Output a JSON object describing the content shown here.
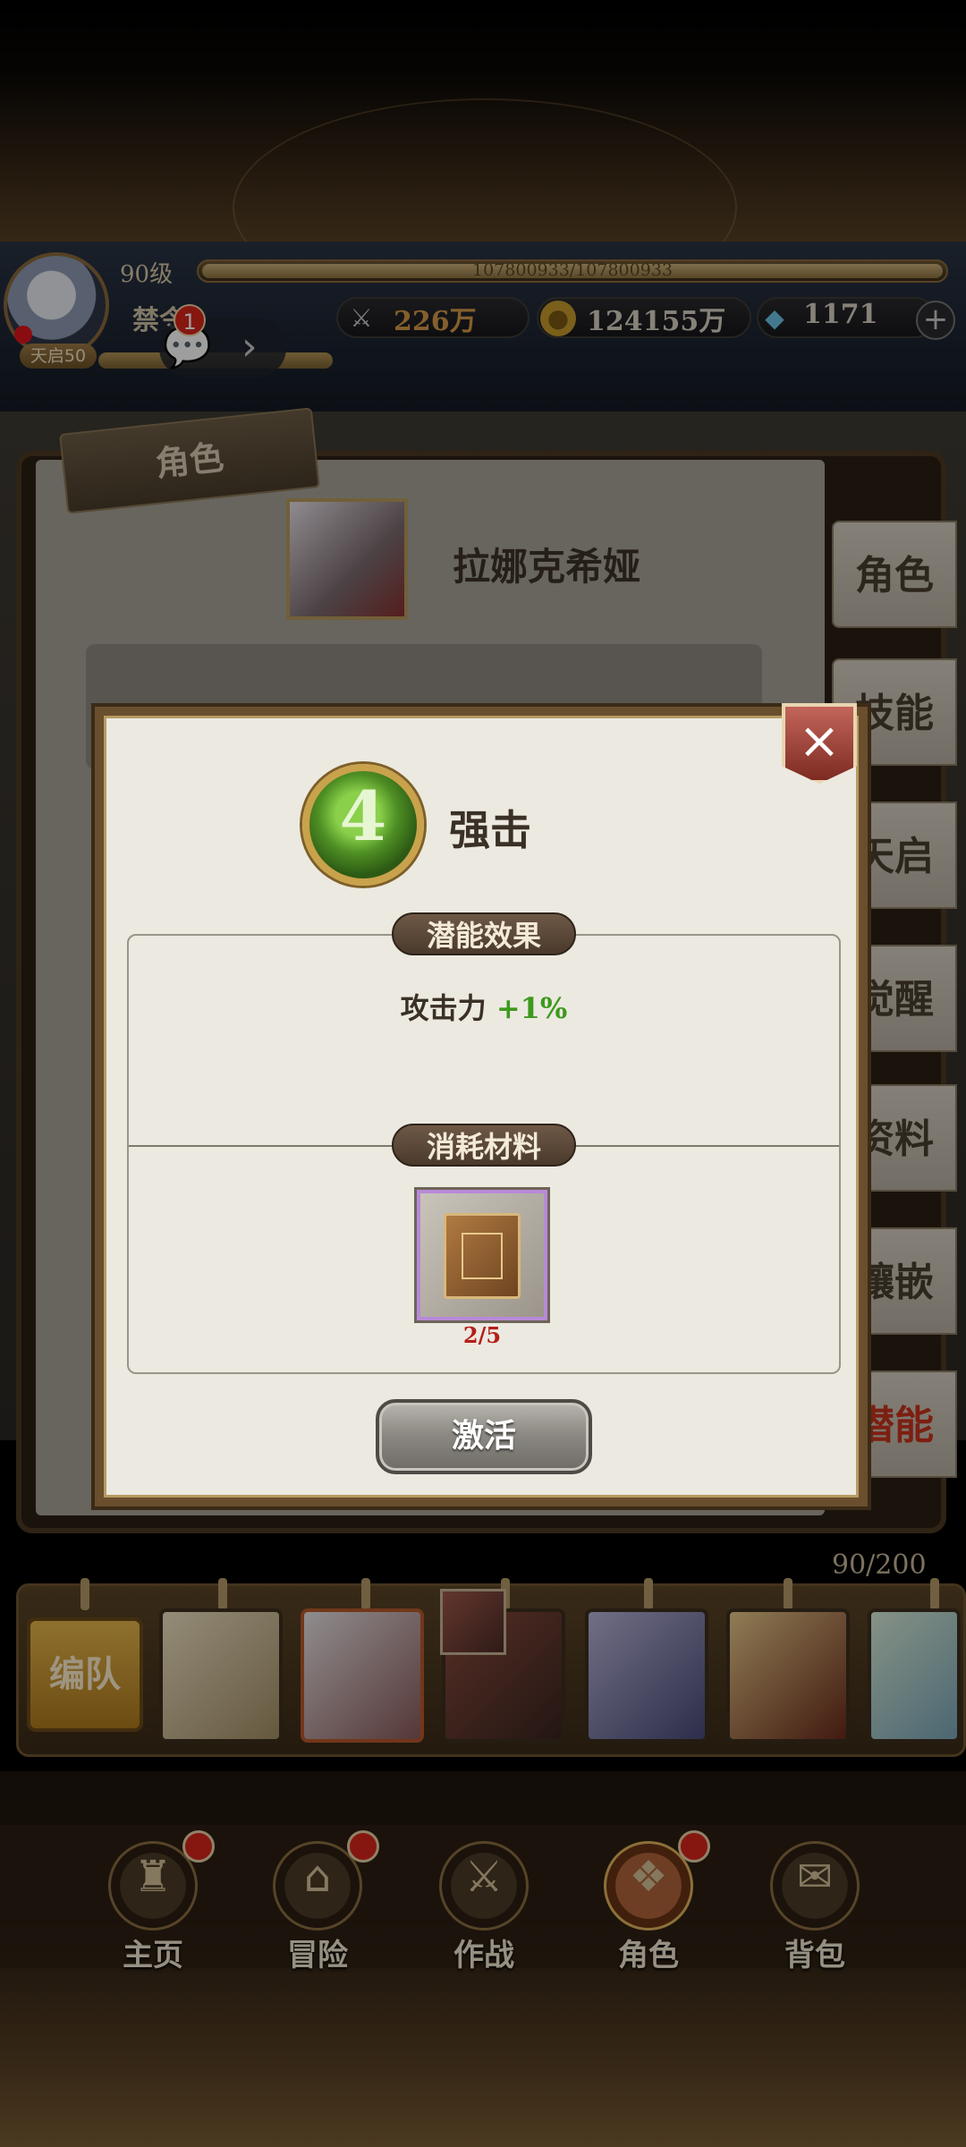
{
  "header": {
    "level": "90级",
    "exp_text": "107800933/107800933",
    "player_name": "禁令",
    "title_badge": "天启50",
    "chat_badge": "1",
    "resources": [
      {
        "name": "combat-power",
        "icon": "swords-icon",
        "value": "226万",
        "color": "#d59a4a"
      },
      {
        "name": "gold",
        "icon": "gold-coin-icon",
        "value": "124155万",
        "color": "#d8d2c4"
      },
      {
        "name": "gems",
        "icon": "crystal-icon",
        "value": "1171",
        "color": "#d8d2c4"
      }
    ]
  },
  "page": {
    "tag": "角色",
    "character_name": "拉娜克希娅",
    "side_tabs": [
      "角色",
      "技能",
      "天启",
      "觉醒",
      "资料",
      "镶嵌",
      "潜能"
    ],
    "active_tab": "潜能"
  },
  "modal": {
    "skill_name": "强击",
    "skill_icon": "green-sword-icon",
    "effect_title": "潜能效果",
    "effect_label": "攻击力",
    "effect_value": "+1%",
    "material_title": "消耗材料",
    "material_icon": "spellbook-icon",
    "material_count": "2/5",
    "activate_label": "激活",
    "close_icon": "close-icon"
  },
  "team": {
    "count": "90/200",
    "button_label": "编队"
  },
  "nav": {
    "items": [
      {
        "label": "主页",
        "icon": "home-icon",
        "badge": true
      },
      {
        "label": "冒险",
        "icon": "adventure-icon",
        "badge": true
      },
      {
        "label": "作战",
        "icon": "battle-icon",
        "badge": false
      },
      {
        "label": "角色",
        "icon": "character-book-icon",
        "badge": true
      },
      {
        "label": "背包",
        "icon": "backpack-icon",
        "badge": false
      }
    ],
    "active": "角色"
  },
  "colors": {
    "accent_green": "#3d9a1e",
    "material_count_red": "#b51e17",
    "badge_red": "#d8261a"
  }
}
